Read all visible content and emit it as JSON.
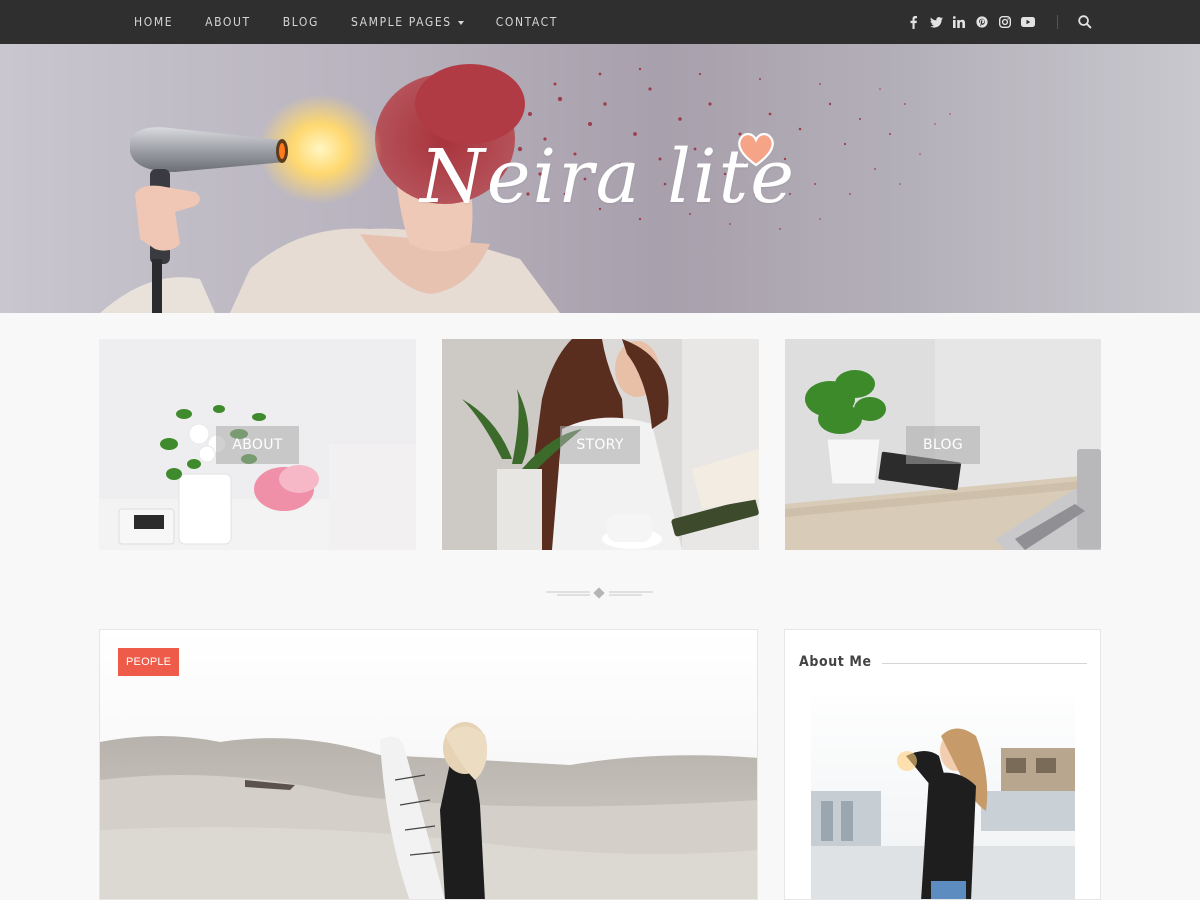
{
  "nav": {
    "items": [
      {
        "label": "HOME"
      },
      {
        "label": "ABOUT"
      },
      {
        "label": "BLOG"
      },
      {
        "label": "SAMPLE PAGES",
        "has_dropdown": true
      },
      {
        "label": "CONTACT"
      }
    ],
    "social_icons": [
      "facebook-icon",
      "twitter-icon",
      "linkedin-icon",
      "pinterest-icon",
      "instagram-icon",
      "youtube-icon"
    ],
    "search_icon": "search-icon"
  },
  "hero": {
    "logo_text": "Neira lite",
    "logo_icon": "heart-icon"
  },
  "promo": [
    {
      "label": "ABOUT"
    },
    {
      "label": "STORY"
    },
    {
      "label": "BLOG"
    }
  ],
  "post": {
    "category": "PEOPLE"
  },
  "sidebar": {
    "widget_title": "About Me"
  },
  "colors": {
    "topbar": "#2f2f2f",
    "accent": "#ee5b49",
    "heart": "#f6a488",
    "background": "#f8f8f8"
  }
}
